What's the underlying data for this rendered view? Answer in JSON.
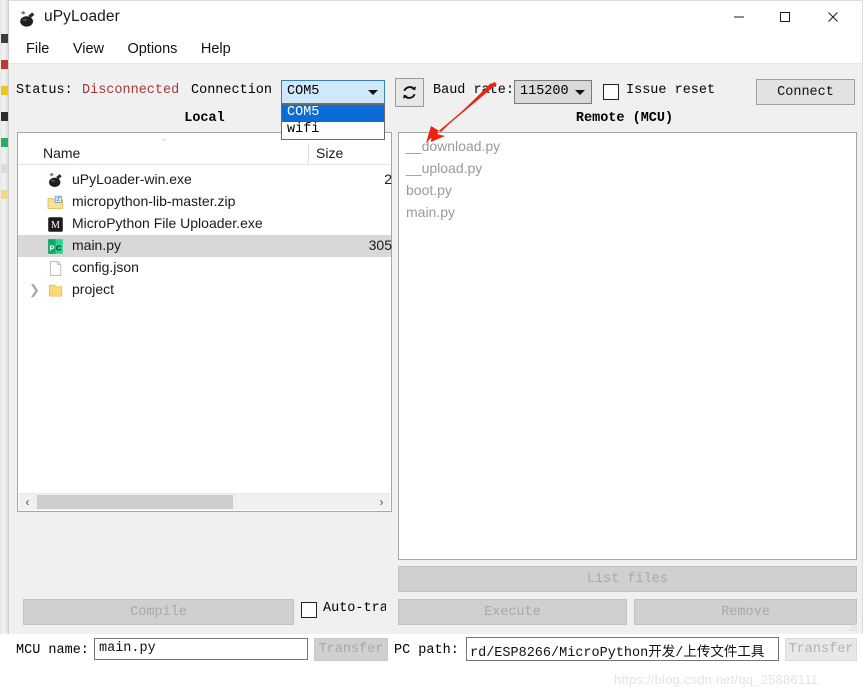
{
  "window": {
    "title": "uPyLoader",
    "icon": "app-bomb-icon",
    "minimize": "—",
    "maximize": "☐",
    "close": "✕"
  },
  "menubar": {
    "items": [
      {
        "label": "File"
      },
      {
        "label": "View"
      },
      {
        "label": "Options"
      },
      {
        "label": "Help"
      }
    ]
  },
  "toolbar": {
    "status_label": "Status:",
    "status_value": "Disconnected",
    "status_color": "#a33a3a",
    "connection_label": "Connection",
    "connection_combo": {
      "value": "COM5",
      "expanded": true,
      "options": [
        {
          "label": "COM5",
          "selected": true
        },
        {
          "label": "wifi",
          "selected": false
        }
      ]
    },
    "refresh_icon": "refresh-icon",
    "baud_label": "Baud rate:",
    "baud_combo": {
      "value": "115200"
    },
    "issue_reset_label": "Issue reset",
    "issue_reset_checked": false,
    "connect_label": "Connect"
  },
  "panels": {
    "local_header": "Local",
    "remote_header": "Remote (MCU)"
  },
  "local_list": {
    "columns": [
      "Name",
      "Size"
    ],
    "sort_indicator": "⌄",
    "rows": [
      {
        "name": "uPyLoader-win.exe",
        "size": "2",
        "icon": "exe-bomb-icon",
        "selected": false,
        "expandable": false
      },
      {
        "name": "micropython-lib-master.zip",
        "size": "",
        "icon": "zip-folder-icon",
        "selected": false,
        "expandable": false
      },
      {
        "name": "MicroPython File Uploader.exe",
        "size": "",
        "icon": "uploader-app-icon",
        "selected": false,
        "expandable": false
      },
      {
        "name": "main.py",
        "size": "305",
        "icon": "pycharm-file-icon",
        "selected": true,
        "expandable": false
      },
      {
        "name": "config.json",
        "size": "",
        "icon": "blank-document-icon",
        "selected": false,
        "expandable": false
      },
      {
        "name": "project",
        "size": "",
        "icon": "folder-icon",
        "selected": false,
        "expandable": true
      }
    ],
    "hscroll": {
      "left_arrow": "‹",
      "right_arrow": "›"
    }
  },
  "remote_list": {
    "rows": [
      {
        "name": "__download.py"
      },
      {
        "name": "__upload.py"
      },
      {
        "name": "boot.py"
      },
      {
        "name": "main.py"
      }
    ]
  },
  "actions": {
    "list_files": "List files",
    "compile": "Compile",
    "execute": "Execute",
    "remove": "Remove",
    "auto_transfer_label": "Auto-transfer",
    "auto_transfer_checked": false
  },
  "bottom_bar": {
    "mcu_name_label": "MCU name:",
    "mcu_name_value": "main.py",
    "mcu_transfer_label": "Transfer",
    "pc_path_label": "PC path:",
    "pc_path_value": "rd/ESP8266/MicroPython开发/上传文件工具",
    "pc_transfer_label": "Transfer"
  },
  "watermark": {
    "text": "https://blog.csdn.net/qq_25886111"
  },
  "annotation": {
    "arrow_color": "#ee2211",
    "points_to": "refresh-button"
  }
}
